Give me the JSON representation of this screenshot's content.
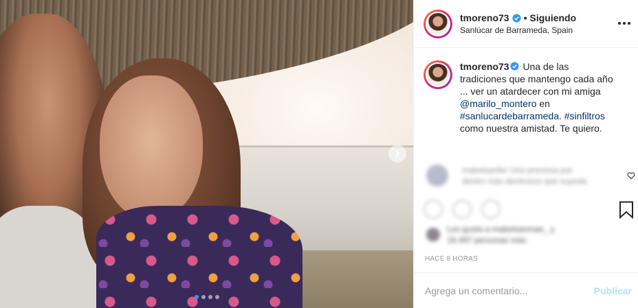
{
  "post": {
    "username": "tmoreno73",
    "separator": "•",
    "follow_status": "Siguiendo",
    "location": "Sanlúcar de Barrameda, Spain"
  },
  "caption": {
    "username": "tmoreno73",
    "text_1": " Una de las tradiciones que mantengo cada año ... ver un atardecer con mi amiga ",
    "mention": "@marilo_montero",
    "text_2": " en ",
    "hashtag_1": "#sanlucardebarrameda",
    "text_3": ". ",
    "hashtag_2": "#sinfiltros",
    "text_4": " como nuestra amistad. Te quiero."
  },
  "blurred_comment": {
    "line_1": "mabelsanfer Una preciosa por",
    "line_2": "dentro más dentrosos que suyeda"
  },
  "blurred_likes": {
    "line_1": "Les gusta a mabelsanmae_ y",
    "line_2": "16.497 personas más"
  },
  "timestamp": "HACE 8 HORAS",
  "comment_box": {
    "placeholder": "Agrega un comentario...",
    "publish_label": "Publicar"
  },
  "carousel": {
    "slide_count": 4,
    "active_index": 0
  },
  "colors": {
    "verified": "#3897f0",
    "link": "#003569",
    "publish_disabled": "#b2dffc"
  },
  "icons": {
    "verified": "verified-badge-icon",
    "more": "more-options-icon",
    "next": "chevron-right-icon",
    "like": "heart-icon",
    "bookmark": "bookmark-icon"
  }
}
